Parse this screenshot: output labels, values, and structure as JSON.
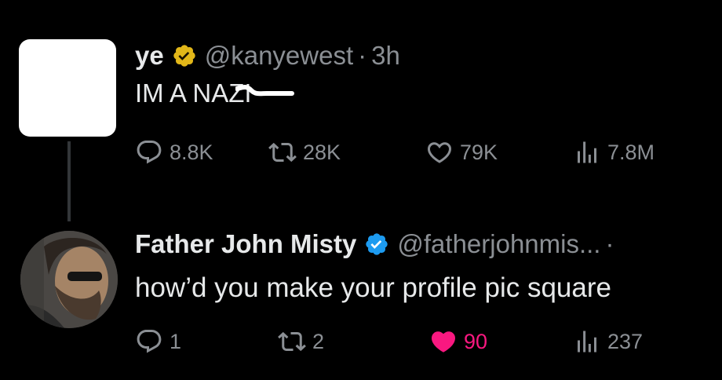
{
  "tweets": [
    {
      "display_name": "ye",
      "handle": "@kanyewest",
      "separator": "·",
      "time": "3h",
      "text": "IM A NAZI",
      "badge_color": "#e2b719",
      "actions": {
        "replies": "8.8K",
        "retweets": "28K",
        "likes": "79K",
        "views": "7.8M"
      }
    },
    {
      "display_name": "Father John Misty",
      "handle": "@fatherjohnmis...",
      "separator": "·",
      "text": "how’d you make your profile pic square",
      "badge_color": "#1d9bf0",
      "actions": {
        "replies": "1",
        "retweets": "2",
        "likes": "90",
        "views": "237",
        "liked": true
      }
    }
  ],
  "colors": {
    "background": "#000000",
    "text": "#e7e9ea",
    "muted": "#8b8f94",
    "like_active": "#f91880",
    "thread_line": "#333639"
  },
  "icons": {
    "reply": "reply-icon",
    "retweet": "retweet-icon",
    "like": "heart-icon",
    "views": "views-icon",
    "badge": "verified-badge-icon"
  }
}
